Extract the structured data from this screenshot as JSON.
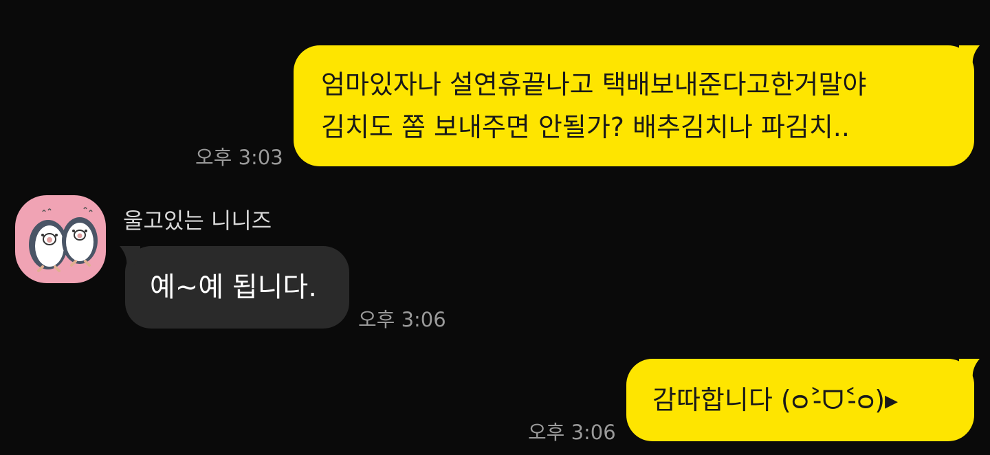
{
  "messages": [
    {
      "direction": "outgoing",
      "lines": [
        "엄마있자나 설연휴끝나고 택배보내준다고한거말야",
        "김치도 쫌 보내주면 안될가? 배추김치나 파김치.."
      ],
      "time": "오후 3:03"
    },
    {
      "direction": "incoming",
      "sender": "울고있는 니니즈",
      "text": "예~예 됩니다.",
      "time": "오후 3:06"
    },
    {
      "direction": "outgoing",
      "text": "감따합니다 (ᴑ˃̵ᗜ˂̵ᴑ)▸",
      "time": "오후 3:06"
    }
  ],
  "avatar": {
    "icon": "penguins-avatar-icon"
  },
  "colors": {
    "background": "#0a0a0a",
    "outgoing_bubble": "#fee500",
    "incoming_bubble": "#2a2a2a",
    "time_text": "#9a9a9a"
  }
}
